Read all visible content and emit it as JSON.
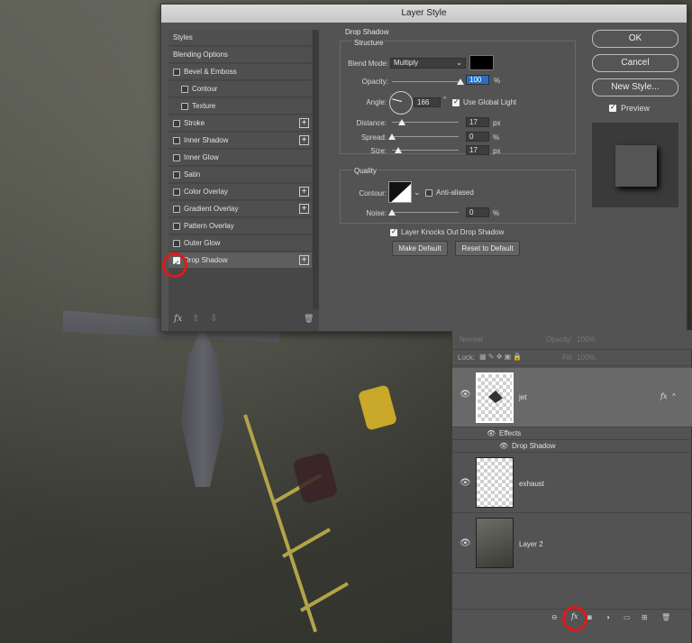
{
  "dialog": {
    "title": "Layer Style",
    "styles_list": [
      {
        "label": "Styles",
        "checkbox": false,
        "plus": false,
        "indent": 0
      },
      {
        "label": "Blending Options",
        "checkbox": false,
        "plus": false,
        "indent": 0
      },
      {
        "label": "Bevel & Emboss",
        "checkbox": true,
        "checked": false,
        "plus": false,
        "indent": 0
      },
      {
        "label": "Contour",
        "checkbox": true,
        "checked": false,
        "plus": false,
        "indent": 1
      },
      {
        "label": "Texture",
        "checkbox": true,
        "checked": false,
        "plus": false,
        "indent": 1
      },
      {
        "label": "Stroke",
        "checkbox": true,
        "checked": false,
        "plus": true,
        "indent": 0
      },
      {
        "label": "Inner Shadow",
        "checkbox": true,
        "checked": false,
        "plus": true,
        "indent": 0
      },
      {
        "label": "Inner Glow",
        "checkbox": true,
        "checked": false,
        "plus": false,
        "indent": 0
      },
      {
        "label": "Satin",
        "checkbox": true,
        "checked": false,
        "plus": false,
        "indent": 0
      },
      {
        "label": "Color Overlay",
        "checkbox": true,
        "checked": false,
        "plus": true,
        "indent": 0
      },
      {
        "label": "Gradient Overlay",
        "checkbox": true,
        "checked": false,
        "plus": true,
        "indent": 0
      },
      {
        "label": "Pattern Overlay",
        "checkbox": true,
        "checked": false,
        "plus": false,
        "indent": 0
      },
      {
        "label": "Outer Glow",
        "checkbox": true,
        "checked": false,
        "plus": false,
        "indent": 0
      },
      {
        "label": "Drop Shadow",
        "checkbox": true,
        "checked": true,
        "plus": true,
        "indent": 0,
        "selected": true
      }
    ],
    "footer": {
      "fx": "fx",
      "up": "⇧",
      "down": "⇩",
      "trash": "🗑"
    },
    "drop_shadow": {
      "title": "Drop Shadow",
      "structure": "Structure",
      "blend_mode_label": "Blend Mode:",
      "blend_mode_value": "Multiply",
      "shadow_color": "#000000",
      "opacity_label": "Opacity:",
      "opacity_value": "100",
      "opacity_unit": "%",
      "angle_label": "Angle:",
      "angle_value": "166",
      "angle_unit": "°",
      "global_light_label": "Use Global Light",
      "distance_label": "Distance:",
      "distance_value": "17",
      "distance_unit": "px",
      "spread_label": "Spread:",
      "spread_value": "0",
      "spread_unit": "%",
      "size_label": "Size:",
      "size_value": "17",
      "size_unit": "px",
      "quality": "Quality",
      "contour_label": "Contour:",
      "anti_aliased_label": "Anti-aliased",
      "noise_label": "Noise:",
      "noise_value": "0",
      "noise_unit": "%",
      "knocks_out_label": "Layer Knocks Out Drop Shadow",
      "make_default": "Make Default",
      "reset_default": "Reset to Default"
    },
    "buttons": {
      "ok": "OK",
      "cancel": "Cancel",
      "new_style": "New Style...",
      "preview": "Preview"
    }
  },
  "layers_panel": {
    "blend_mode": "Normal",
    "opacity_label": "Opacity:",
    "opacity_value": "100%",
    "lock_label": "Lock:",
    "fill_label": "Fill:",
    "fill_value": "100%",
    "layers": [
      {
        "name": "jet",
        "fx": "fx"
      },
      {
        "name": "exhaust"
      },
      {
        "name": "Layer 2"
      }
    ],
    "effects_label": "Effects",
    "drop_shadow_effect": "Drop Shadow",
    "footer_fx": "fx"
  }
}
